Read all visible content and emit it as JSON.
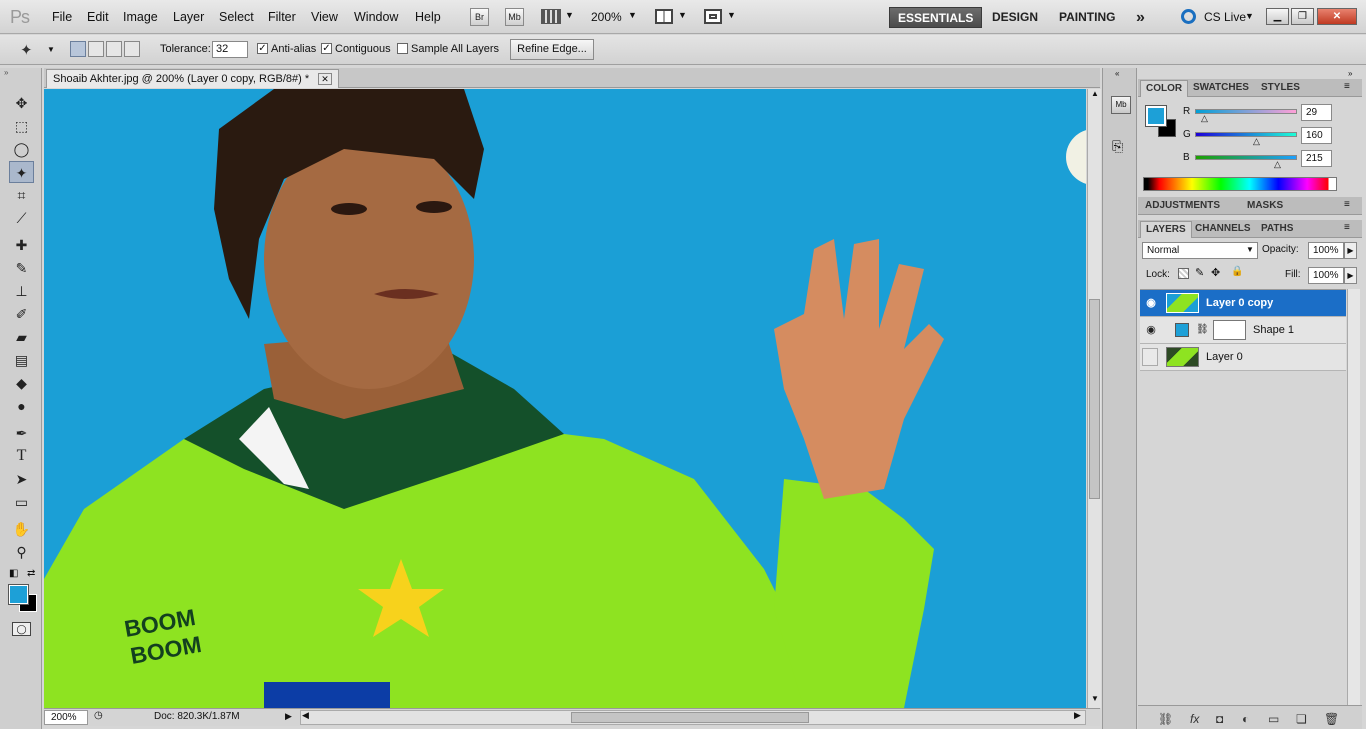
{
  "app": {
    "logo": "Ps"
  },
  "menu": [
    "File",
    "Edit",
    "Image",
    "Layer",
    "Select",
    "Filter",
    "View",
    "Window",
    "Help"
  ],
  "menubar_buttons": {
    "bridge": "Br",
    "minibridge": "Mb",
    "zoom": "200%"
  },
  "workspaces": {
    "essentials": "ESSENTIALS",
    "design": "DESIGN",
    "painting": "PAINTING",
    "more": "»"
  },
  "cslive": "CS Live",
  "options": {
    "tolerance_label": "Tolerance:",
    "tolerance_value": "32",
    "antialias": "Anti-alias",
    "contiguous": "Contiguous",
    "sample_all": "Sample All Layers",
    "refine_edge": "Refine Edge..."
  },
  "document": {
    "tab_title": "Shoaib Akhter.jpg @ 200% (Layer 0 copy, RGB/8#) *",
    "zoom": "200%",
    "doc_size": "Doc: 820.3K/1.87M",
    "canvas_color": "#1b9fd6",
    "shirt_text_1": "BOOM",
    "shirt_text_2": "BOOM"
  },
  "color_panel": {
    "tabs": [
      "COLOR",
      "SWATCHES",
      "STYLES"
    ],
    "r_label": "R",
    "r_value": "29",
    "g_label": "G",
    "g_value": "160",
    "b_label": "B",
    "b_value": "215",
    "foreground": "#1da0d7",
    "background": "#000000"
  },
  "adjustments": {
    "tabs": [
      "ADJUSTMENTS",
      "MASKS"
    ]
  },
  "layers_panel": {
    "tabs": [
      "LAYERS",
      "CHANNELS",
      "PATHS"
    ],
    "blend_mode": "Normal",
    "opacity_label": "Opacity:",
    "opacity_value": "100%",
    "lock_label": "Lock:",
    "fill_label": "Fill:",
    "fill_value": "100%",
    "layers": [
      {
        "name": "Layer 0 copy",
        "visible": true,
        "selected": true
      },
      {
        "name": "Shape 1",
        "visible": true,
        "selected": false
      },
      {
        "name": "Layer 0",
        "visible": false,
        "selected": false
      }
    ]
  }
}
